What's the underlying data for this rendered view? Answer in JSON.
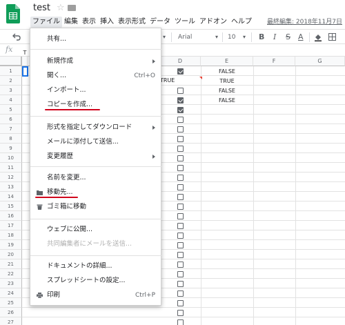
{
  "header": {
    "title": "test",
    "last_edit": "最終編集: 2018年11月7日",
    "menus": [
      "ファイル",
      "編集",
      "表示",
      "挿入",
      "表示形式",
      "データ",
      "ツール",
      "アドオン",
      "ヘルプ"
    ]
  },
  "toolbar": {
    "font": "Arial",
    "font_size": "10",
    "bold": "B",
    "italic": "I",
    "strike": "S",
    "text_color": "A",
    "font_caret": "▾",
    "size_caret": "▾"
  },
  "formula_bar": {
    "fx": "fx"
  },
  "grid": {
    "columns": [
      "D",
      "E",
      "F",
      "G"
    ],
    "rows": [
      "1",
      "2",
      "3",
      "4",
      "5",
      "6",
      "7",
      "8",
      "9",
      "10",
      "11",
      "12",
      "13",
      "14",
      "15",
      "16",
      "17",
      "18",
      "19",
      "20",
      "21",
      "22",
      "23",
      "24",
      "25",
      "26",
      "27"
    ],
    "col_e_values": [
      "FALSE",
      "TRUE",
      "FALSE",
      "FALSE"
    ],
    "c2_value": "TRUE",
    "d_checked": [
      true,
      null,
      false,
      true,
      true
    ],
    "partial_header": "T"
  },
  "file_menu": {
    "share": "共有...",
    "new": "新規作成",
    "open": "開く...",
    "open_shortcut": "Ctrl+O",
    "import": "インポート...",
    "make_copy": "コピーを作成...",
    "download_as": "形式を指定してダウンロード",
    "email_attachment": "メールに添付して送信...",
    "version_history": "変更履歴",
    "rename": "名前を変更...",
    "move_to": "移動先...",
    "trash": "ゴミ箱に移動",
    "publish_web": "ウェブに公開...",
    "email_collaborators": "共同編集者にメールを送信...",
    "doc_details": "ドキュメントの詳細...",
    "spreadsheet_settings": "スプレッドシートの設定...",
    "print": "印刷",
    "print_shortcut": "Ctrl+P"
  },
  "colors": {
    "accent": "#1a73e8",
    "sheets_green": "#0f9d58",
    "annotation_red": "#d0021b"
  }
}
